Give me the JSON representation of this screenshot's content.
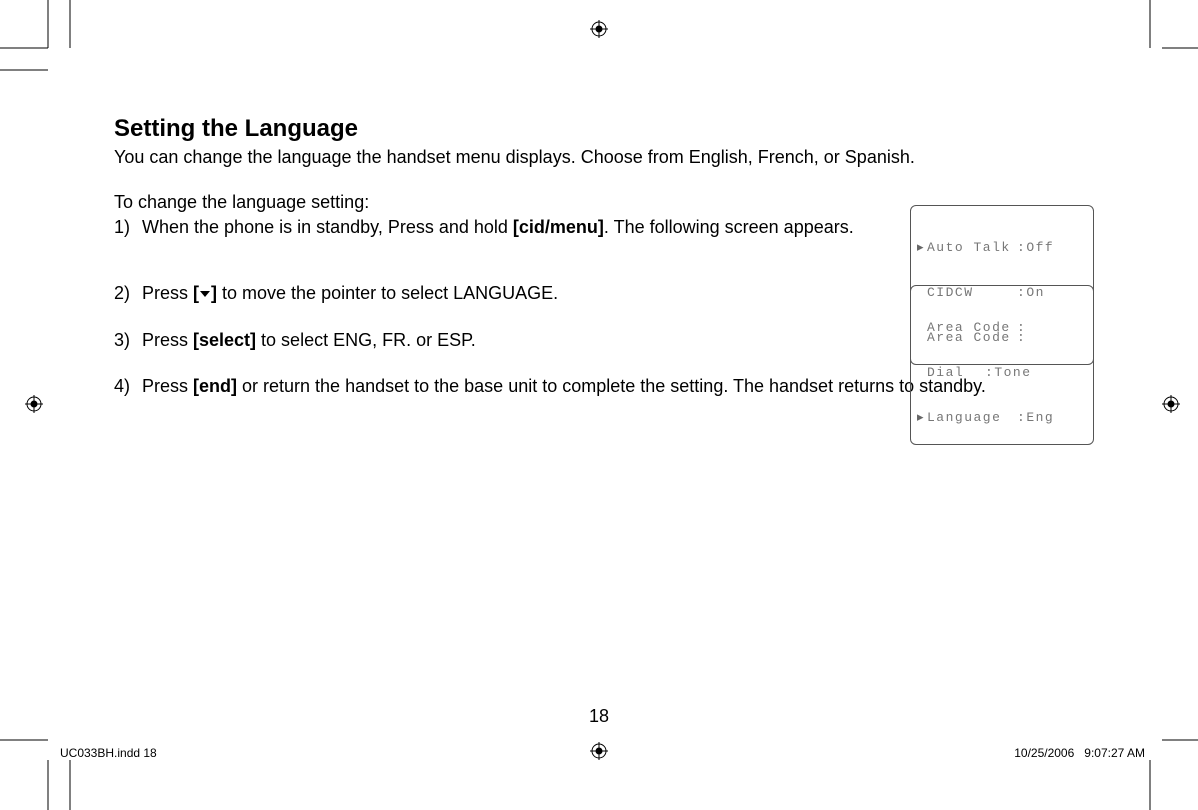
{
  "heading": "Setting the Language",
  "intro": "You can change the language the handset menu displays. Choose from English, French, or Spanish.",
  "lead": "To change the language setting:",
  "steps": [
    {
      "num": "1)",
      "pre": "When the phone is in standby, Press and hold ",
      "bold": "[cid/menu]",
      "post": ". The following screen appears."
    },
    {
      "num": "2)",
      "pre": "Press ",
      "bold_open": "[",
      "bold_close": "]",
      "post": " to move the pointer to select LANGUAGE."
    },
    {
      "num": "3)",
      "pre": "Press ",
      "bold": "[select]",
      "post": " to select ENG, FR. or ESP."
    },
    {
      "num": "4)",
      "pre": "Press ",
      "bold": "[end]",
      "post": " or return the handset to the base unit to complete the setting. The handset returns to standby."
    }
  ],
  "lcd1": {
    "rows": [
      {
        "ptr": "▸",
        "label": "Auto Talk",
        "sep": ":",
        "val": "Off"
      },
      {
        "ptr": " ",
        "label": "CIDCW",
        "sep": ":",
        "val": "On"
      },
      {
        "ptr": " ",
        "label": "Area Code",
        "sep": ":",
        "val": ""
      }
    ]
  },
  "lcd2": {
    "rows": [
      {
        "ptr": " ",
        "label": "Area Code",
        "sep": ":",
        "val": ""
      },
      {
        "ptr": " ",
        "label": "Dial",
        "sep": ":",
        "val": "Tone"
      },
      {
        "ptr": "▸",
        "label": "Language",
        "sep": ":",
        "val": "Eng"
      }
    ]
  },
  "page_number": "18",
  "footer": {
    "left": "UC033BH.indd   18",
    "right": "10/25/2006   9:07:27 AM"
  }
}
